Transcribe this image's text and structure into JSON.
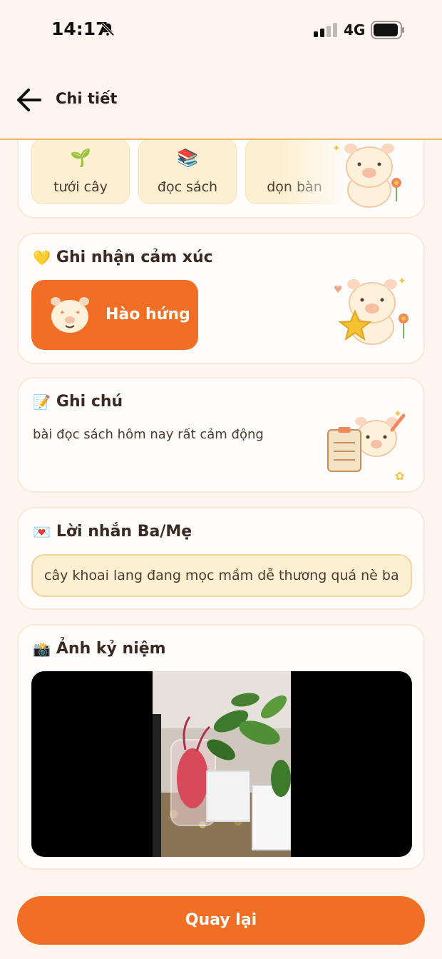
{
  "status": {
    "time": "14:17",
    "network": "4G"
  },
  "header": {
    "title": "Chi tiết"
  },
  "activities": [
    {
      "icon": "🌱",
      "label": "tưới cây"
    },
    {
      "icon": "📚",
      "label": "đọc sách"
    },
    {
      "icon": "",
      "label": "dọn bàn"
    }
  ],
  "emotion": {
    "title": "Ghi nhận cảm xúc",
    "icon": "💛",
    "mood_label": "Hào hứng"
  },
  "note": {
    "title": "Ghi chú",
    "icon": "📝",
    "text": "bài đọc sách hôm nay rất cảm động"
  },
  "parent_message": {
    "title": "Lời nhắn Ba/Mẹ",
    "icon": "💌",
    "text": "cây khoai lang đang mọc mầm dễ thương quá nè ba"
  },
  "memory_photo": {
    "title": "Ảnh kỷ niệm",
    "icon": "📸"
  },
  "back_button": {
    "label": "Quay lại"
  },
  "colors": {
    "accent": "#f06f24",
    "background": "#fdf5ee",
    "tile": "#fdf0d2",
    "border": "#f2b35e"
  }
}
